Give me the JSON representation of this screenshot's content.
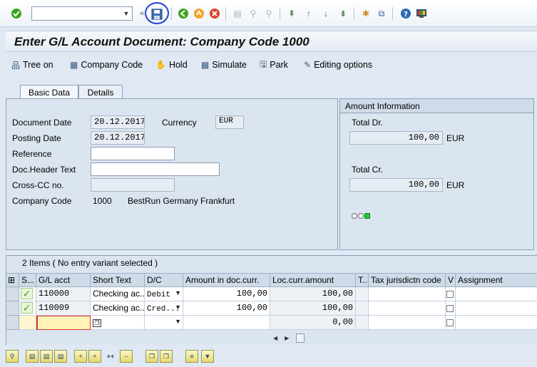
{
  "toolbar": {
    "command_value": "",
    "icons": [
      "enter-icon",
      "command-dropdown-icon",
      "back-double-icon",
      "save-icon",
      "back-icon",
      "exit-icon",
      "cancel-icon",
      "print-icon",
      "find-icon",
      "find-next-icon",
      "first-page-icon",
      "previous-page-icon",
      "next-page-icon",
      "last-page-icon",
      "new-session-icon",
      "shortcut-icon",
      "help-icon",
      "customize-layout-icon"
    ]
  },
  "page": {
    "title": "Enter G/L Account Document: Company Code 1000"
  },
  "app_toolbar": {
    "tree_on": "Tree on",
    "company_code": "Company Code",
    "hold": "Hold",
    "simulate": "Simulate",
    "park": "Park",
    "editing_options": "Editing options"
  },
  "tabs": {
    "basic": "Basic Data",
    "details": "Details"
  },
  "basic_data": {
    "document_date_label": "Document Date",
    "document_date": "20.12.2017",
    "currency_label": "Currency",
    "currency": "EUR",
    "posting_date_label": "Posting Date",
    "posting_date": "20.12.2017",
    "reference_label": "Reference",
    "reference": "",
    "header_text_label": "Doc.Header Text",
    "header_text": "",
    "cross_cc_label": "Cross-CC no.",
    "cross_cc": "",
    "company_code_label": "Company Code",
    "company_code": "1000",
    "company_name": "BestRun Germany Frankfurt"
  },
  "amount_info": {
    "title": "Amount Information",
    "total_dr_label": "Total Dr.",
    "total_dr": "100,00",
    "total_dr_cur": "EUR",
    "total_cr_label": "Total Cr.",
    "total_cr": "100,00",
    "total_cr_cur": "EUR"
  },
  "items": {
    "title": "2 Items ( No entry variant selected )",
    "headers": {
      "status": "S...",
      "gl_acct": "G/L acct",
      "short_text": "Short Text",
      "dc": "D/C",
      "amount_doc": "Amount in doc.curr.",
      "loc_amount": "Loc.curr.amount",
      "tax": "T..",
      "tax_juris": "Tax jurisdictn code",
      "v": "V",
      "assignment": "Assignment"
    },
    "rows": [
      {
        "gl_acct": "110000",
        "short_text": "Checking ac...",
        "dc": "Debit",
        "amount_doc": "100,00",
        "loc_amount": "100,00"
      },
      {
        "gl_acct": "110009",
        "short_text": "Checking ac...",
        "dc": "Cred...",
        "amount_doc": "100,00",
        "loc_amount": "100,00"
      }
    ],
    "empty_loc_amount": "0,00"
  }
}
